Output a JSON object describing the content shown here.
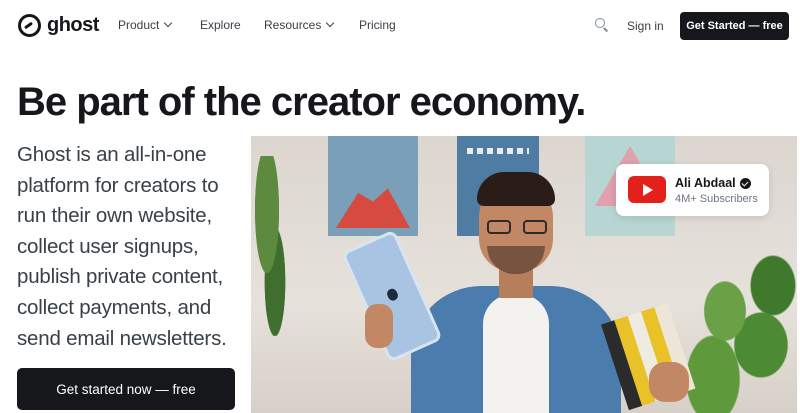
{
  "brand": {
    "name": "ghost"
  },
  "nav": {
    "items": [
      {
        "label": "Product",
        "has_dropdown": true
      },
      {
        "label": "Explore",
        "has_dropdown": false
      },
      {
        "label": "Resources",
        "has_dropdown": true
      },
      {
        "label": "Pricing",
        "has_dropdown": false
      }
    ],
    "search_icon": "search-icon",
    "signin_label": "Sign in",
    "cta_label": "Get Started — free"
  },
  "hero": {
    "title": "Be part of the creator economy.",
    "text_lines": [
      "Ghost is an all-in-one",
      "platform for creators to",
      "run their own website,",
      "collect user signups,",
      "publish private content,",
      "collect payments, and",
      "send email newsletters."
    ],
    "cta_label": "Get started now — free"
  },
  "badge": {
    "name": "Ali Abdaal",
    "subscribers": "4M+ Subscribers",
    "icon": "youtube-icon",
    "verified_icon": "verified-icon"
  },
  "colors": {
    "text_dark": "#15171a",
    "text_muted": "#394047",
    "youtube_red": "#e4201b"
  }
}
